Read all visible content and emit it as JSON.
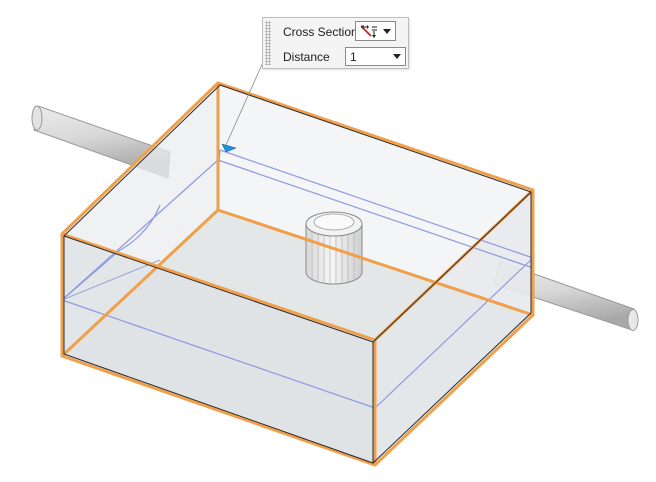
{
  "cross_section_toolbar": {
    "cross_section_label": "Cross Section",
    "cross_section_icon": "cross-section-plane-icon",
    "distance_label": "Distance",
    "distance_value": "1"
  },
  "scene": {
    "box_edge_highlight_color": "#f0a04b",
    "section_plane_color": "#8e9ae0",
    "marker_color": "#1e90e0",
    "shaft_color": "#d4d4d4",
    "knob_color": "#ececec"
  }
}
